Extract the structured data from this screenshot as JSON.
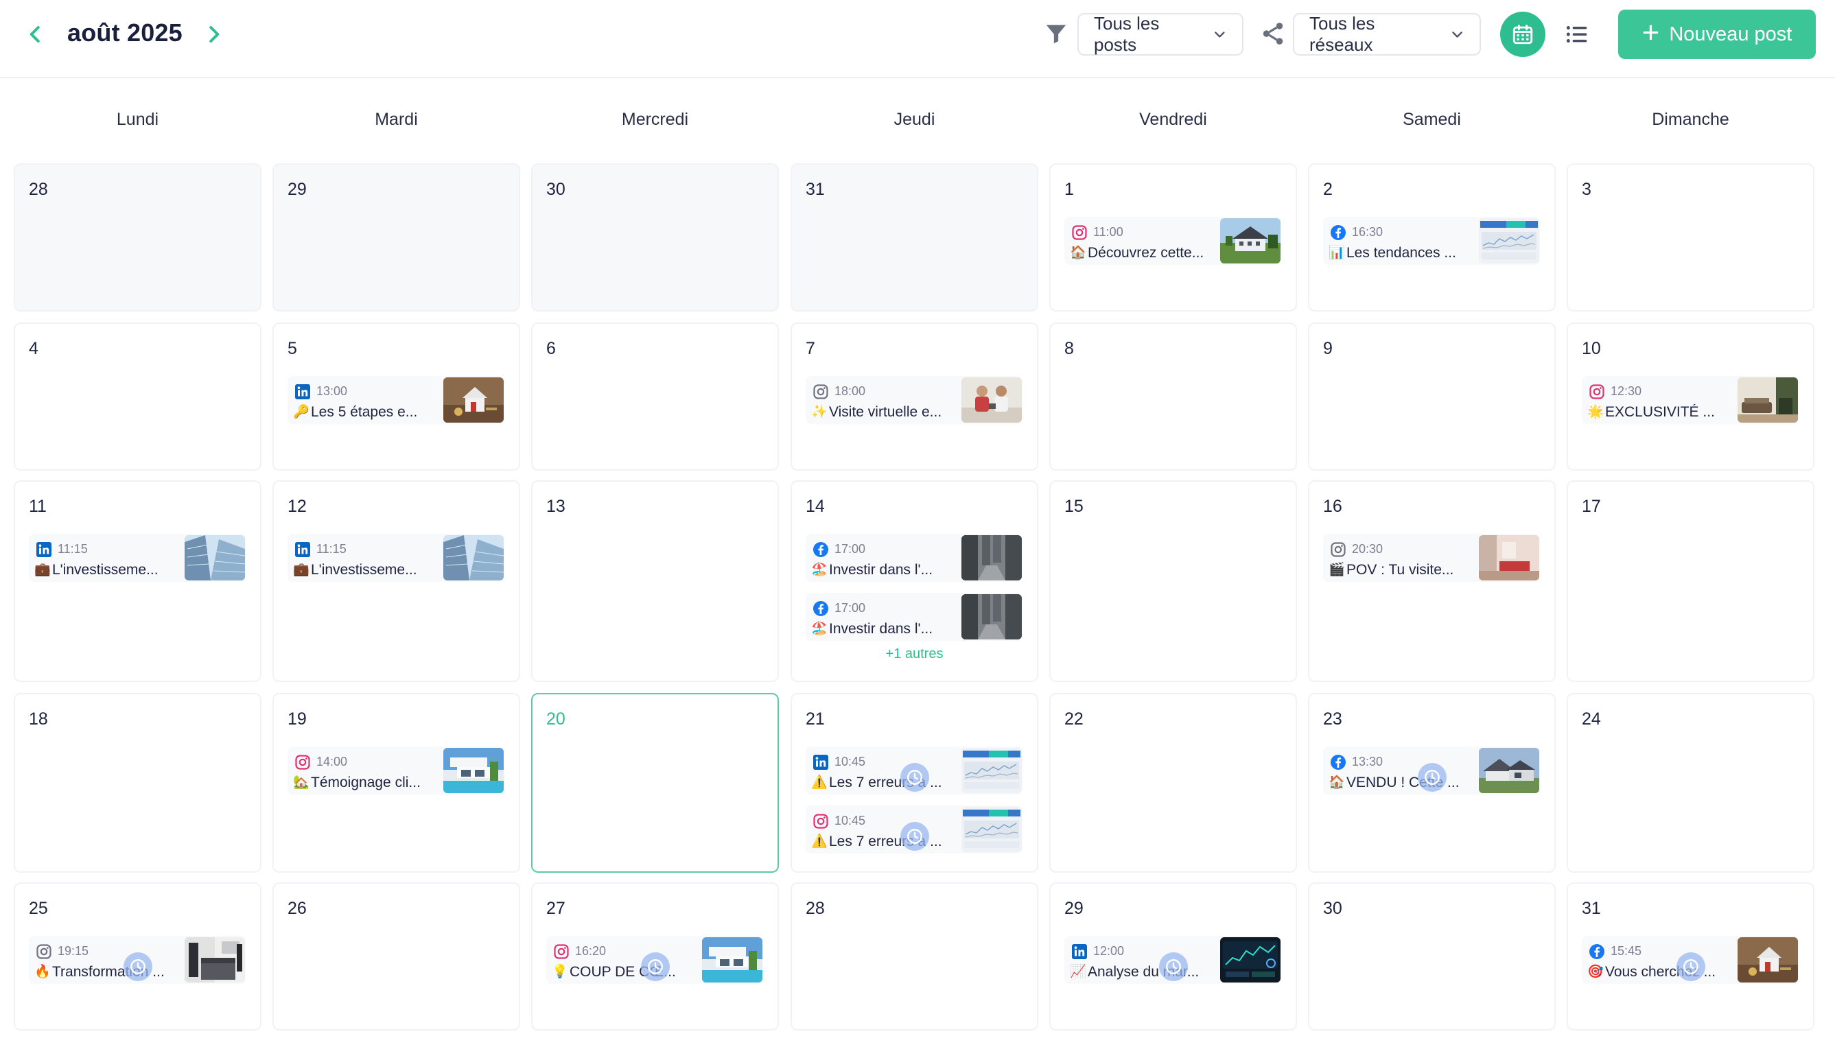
{
  "header": {
    "month_label": "août 2025",
    "filter_posts": "Tous les posts",
    "filter_networks": "Tous les réseaux",
    "new_post_label": "Nouveau post",
    "new_post_plus": "+"
  },
  "weekdays": [
    "Lundi",
    "Mardi",
    "Mercredi",
    "Jeudi",
    "Vendredi",
    "Samedi",
    "Dimanche"
  ],
  "colors": {
    "accent": "#2ebd8f",
    "instagram": "#e1306c",
    "facebook": "#1877f2",
    "linkedin": "#0a66c2"
  },
  "weeks": [
    {
      "days": [
        {
          "num": "28",
          "outside": true,
          "posts": []
        },
        {
          "num": "29",
          "outside": true,
          "posts": []
        },
        {
          "num": "30",
          "outside": true,
          "posts": []
        },
        {
          "num": "31",
          "outside": true,
          "posts": []
        },
        {
          "num": "1",
          "posts": [
            {
              "network": "instagram",
              "time": "11:00",
              "emoji": "🏠",
              "title": "Découvrez cette...",
              "thumb": "house",
              "scheduled": false
            }
          ]
        },
        {
          "num": "2",
          "posts": [
            {
              "network": "facebook",
              "time": "16:30",
              "emoji": "📊",
              "title": "Les tendances ...",
              "thumb": "chart",
              "scheduled": false
            }
          ]
        },
        {
          "num": "3",
          "posts": []
        }
      ]
    },
    {
      "days": [
        {
          "num": "4",
          "posts": []
        },
        {
          "num": "5",
          "posts": [
            {
              "network": "linkedin",
              "time": "13:00",
              "emoji": "🔑",
              "title": "Les 5 étapes e...",
              "thumb": "keys",
              "scheduled": false
            }
          ]
        },
        {
          "num": "6",
          "posts": []
        },
        {
          "num": "7",
          "posts": [
            {
              "network": "instagram-gray",
              "time": "18:00",
              "emoji": "✨",
              "title": "Visite virtuelle e...",
              "thumb": "people",
              "scheduled": false
            }
          ]
        },
        {
          "num": "8",
          "posts": []
        },
        {
          "num": "9",
          "posts": []
        },
        {
          "num": "10",
          "posts": [
            {
              "network": "instagram",
              "time": "12:30",
              "emoji": "🌟",
              "title": "EXCLUSIVITÉ ...",
              "thumb": "interior",
              "scheduled": false
            }
          ]
        }
      ]
    },
    {
      "days": [
        {
          "num": "11",
          "posts": [
            {
              "network": "linkedin",
              "time": "11:15",
              "emoji": "💼",
              "title": "L'investisseme...",
              "thumb": "building",
              "scheduled": false
            }
          ]
        },
        {
          "num": "12",
          "posts": [
            {
              "network": "linkedin",
              "time": "11:15",
              "emoji": "💼",
              "title": "L'investisseme...",
              "thumb": "building",
              "scheduled": false
            }
          ]
        },
        {
          "num": "13",
          "posts": []
        },
        {
          "num": "14",
          "posts": [
            {
              "network": "facebook",
              "time": "17:00",
              "emoji": "🏖️",
              "title": "Investir dans l'...",
              "thumb": "street",
              "scheduled": false
            },
            {
              "network": "facebook",
              "time": "17:00",
              "emoji": "🏖️",
              "title": "Investir dans l'...",
              "thumb": "street",
              "scheduled": false
            }
          ],
          "more": "+1 autres"
        },
        {
          "num": "15",
          "posts": []
        },
        {
          "num": "16",
          "posts": [
            {
              "network": "instagram-gray",
              "time": "20:30",
              "emoji": "🎬",
              "title": "POV : Tu visite...",
              "thumb": "room",
              "scheduled": false
            }
          ]
        },
        {
          "num": "17",
          "posts": []
        }
      ]
    },
    {
      "days": [
        {
          "num": "18",
          "posts": []
        },
        {
          "num": "19",
          "posts": [
            {
              "network": "instagram",
              "time": "14:00",
              "emoji": "🏡",
              "title": "Témoignage cli...",
              "thumb": "villa",
              "scheduled": false
            }
          ]
        },
        {
          "num": "20",
          "today": true,
          "posts": []
        },
        {
          "num": "21",
          "posts": [
            {
              "network": "linkedin",
              "time": "10:45",
              "emoji": "⚠️",
              "title": "Les 7 erreurs à ...",
              "thumb": "chart",
              "scheduled": true
            },
            {
              "network": "instagram",
              "time": "10:45",
              "emoji": "⚠️",
              "title": "Les 7 erreurs à ...",
              "thumb": "chart",
              "scheduled": true
            }
          ]
        },
        {
          "num": "22",
          "posts": []
        },
        {
          "num": "23",
          "posts": [
            {
              "network": "facebook",
              "time": "13:30",
              "emoji": "🏠",
              "title": "VENDU ! Cette ...",
              "thumb": "house2",
              "scheduled": true
            }
          ]
        },
        {
          "num": "24",
          "posts": []
        }
      ]
    },
    {
      "days": [
        {
          "num": "25",
          "posts": [
            {
              "network": "instagram-gray",
              "time": "19:15",
              "emoji": "🔥",
              "title": "Transformation ...",
              "thumb": "kitchen",
              "scheduled": true
            }
          ]
        },
        {
          "num": "26",
          "posts": []
        },
        {
          "num": "27",
          "posts": [
            {
              "network": "instagram",
              "time": "16:20",
              "emoji": "💡",
              "title": "COUP DE CŒ...",
              "thumb": "villa",
              "scheduled": true
            }
          ]
        },
        {
          "num": "28",
          "posts": []
        },
        {
          "num": "29",
          "posts": [
            {
              "network": "linkedin",
              "time": "12:00",
              "emoji": "📈",
              "title": "Analyse du mar...",
              "thumb": "dark",
              "scheduled": true
            }
          ]
        },
        {
          "num": "30",
          "posts": []
        },
        {
          "num": "31",
          "posts": [
            {
              "network": "facebook",
              "time": "15:45",
              "emoji": "🎯",
              "title": "Vous cherchez ...",
              "thumb": "keys",
              "scheduled": true
            }
          ]
        }
      ]
    }
  ]
}
